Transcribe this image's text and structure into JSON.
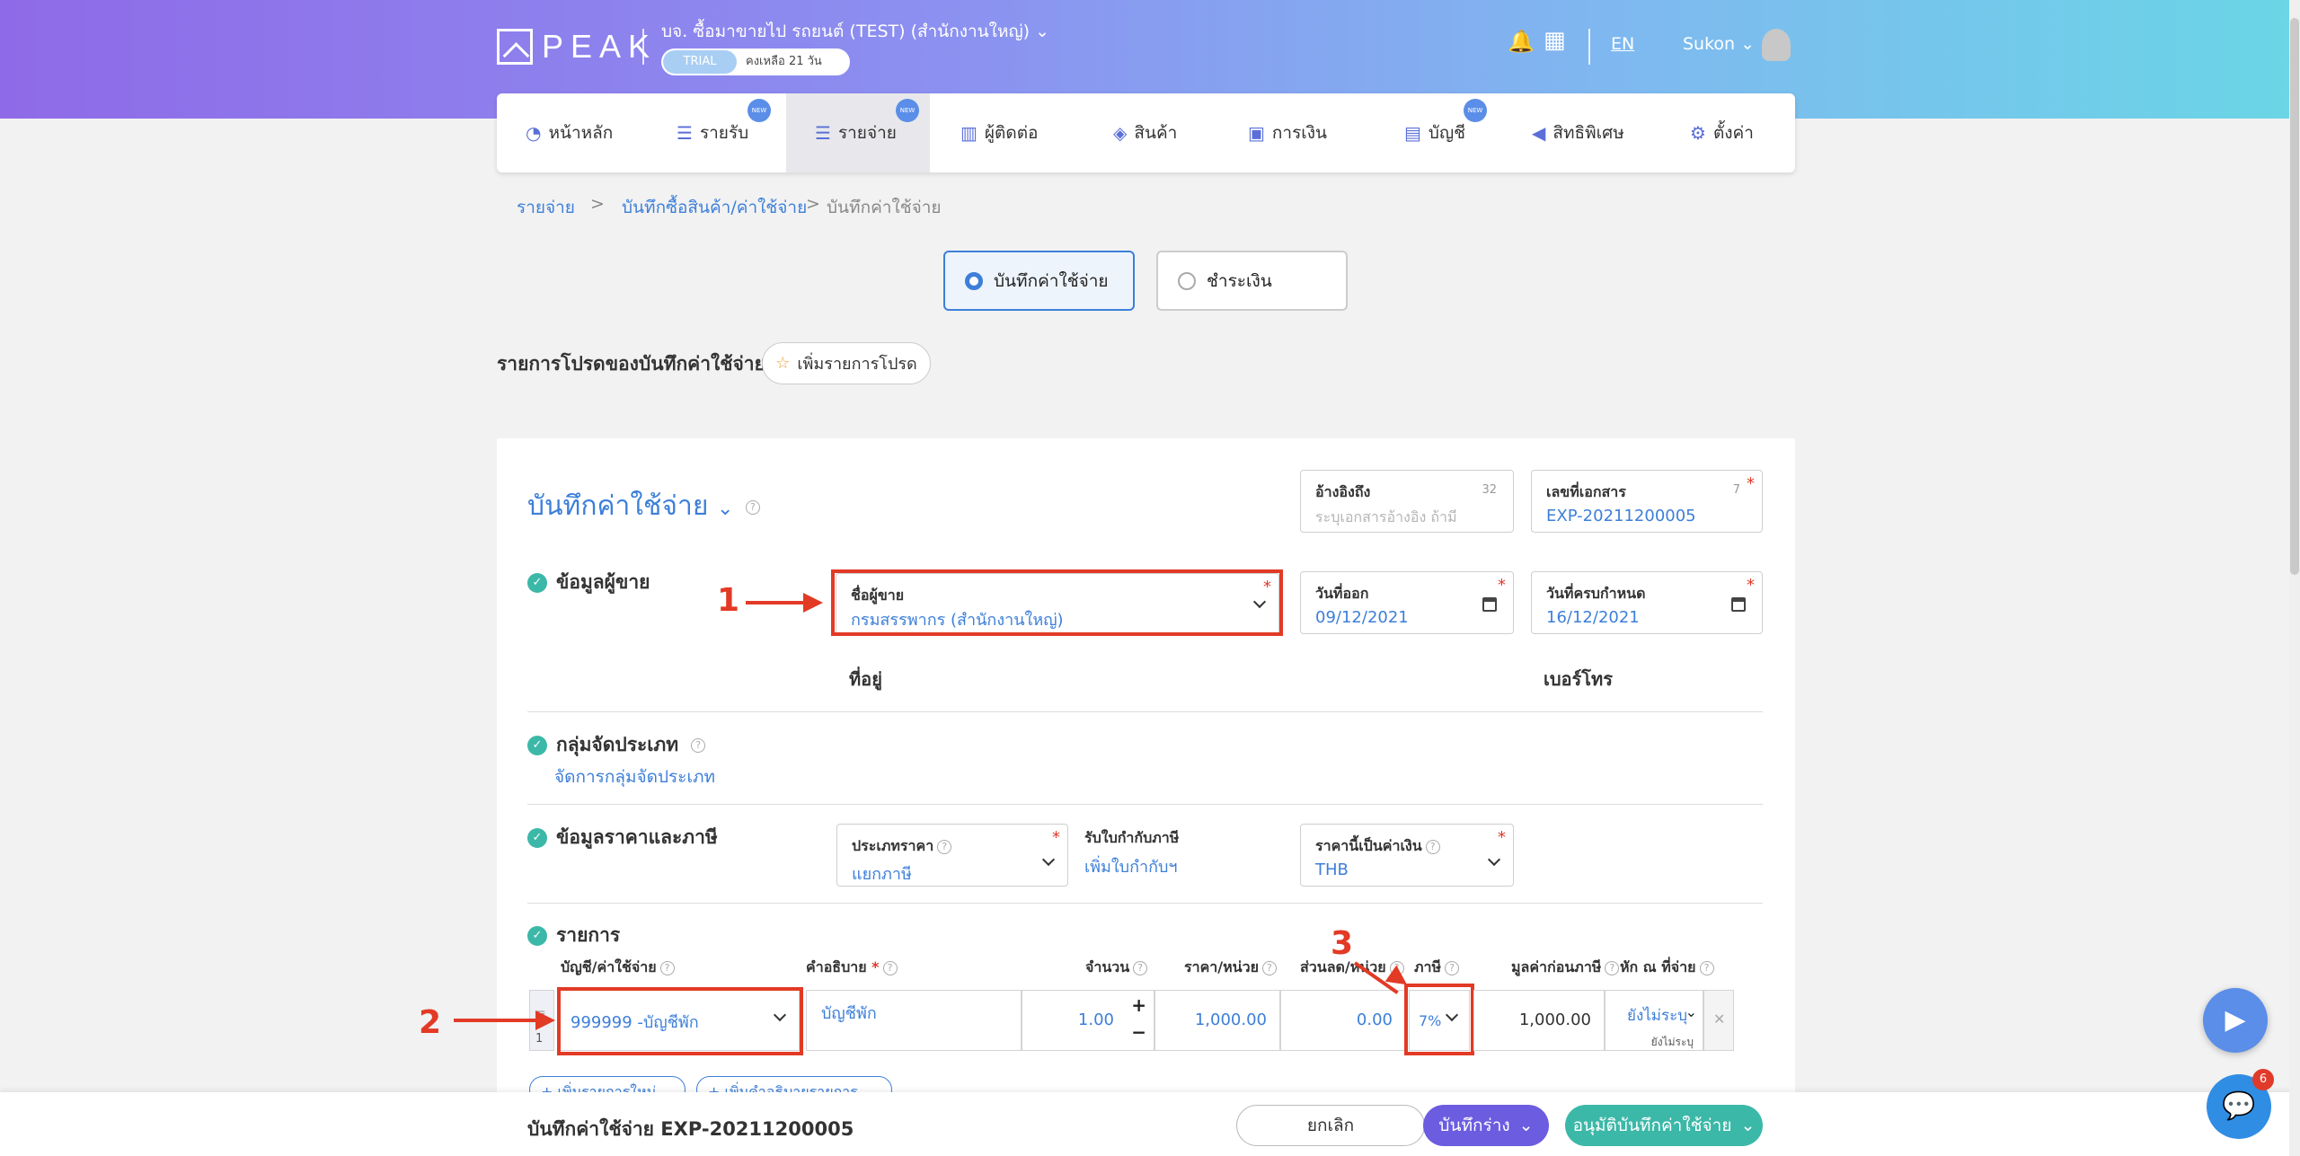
{
  "header": {
    "logo_text": "PEAK",
    "company": "บจ. ซื้อมาขายไป รถยนต์ (TEST) (สำนักงานใหญ่)",
    "trial_label": "TRIAL",
    "trial_days": "คงเหลือ 21 วัน",
    "lang": "EN",
    "user": "Sukon"
  },
  "nav": {
    "items": [
      {
        "label": "หน้าหลัก",
        "icon": "dashboard-icon"
      },
      {
        "label": "รายรับ",
        "icon": "income-icon",
        "badge": "NEW"
      },
      {
        "label": "รายจ่าย",
        "icon": "expense-icon",
        "badge": "NEW"
      },
      {
        "label": "ผู้ติดต่อ",
        "icon": "contacts-icon"
      },
      {
        "label": "สินค้า",
        "icon": "box-icon"
      },
      {
        "label": "การเงิน",
        "icon": "money-icon"
      },
      {
        "label": "บัญชี",
        "icon": "book-icon",
        "badge": "NEW"
      },
      {
        "label": "สิทธิพิเศษ",
        "icon": "megaphone-icon"
      },
      {
        "label": "ตั้งค่า",
        "icon": "gear-icon"
      }
    ]
  },
  "breadcrumb": {
    "b1": "รายจ่าย",
    "sep": ">",
    "b2": "บันทึกซื้อสินค้า/ค่าใช้จ่าย",
    "b3": "บันทึกค่าใช้จ่าย"
  },
  "mode": {
    "opt1": "บันทึกค่าใช้จ่าย",
    "opt2": "ชำระเงิน"
  },
  "favorites": {
    "title": "รายการโปรดของบันทึกค่าใช้จ่าย",
    "add_button": "เพิ่มรายการโปรด"
  },
  "form": {
    "title": "บันทึกค่าใช้จ่าย",
    "reference": {
      "label": "อ้างอิงถึง",
      "placeholder": "ระบุเอกสารอ้างอิง ถ้ามี",
      "count": "32"
    },
    "doc_number": {
      "label": "เลขที่เอกสาร",
      "value": "EXP-20211200005",
      "count": "7"
    },
    "vendor_section": "ข้อมูลผู้ขาย",
    "vendor": {
      "label": "ชื่อผู้ขาย",
      "value": "กรมสรรพากร (สำนักงานใหญ่)"
    },
    "issue_date": {
      "label": "วันที่ออก",
      "value": "09/12/2021"
    },
    "due_date": {
      "label": "วันที่ครบกำหนด",
      "value": "16/12/2021"
    },
    "address_label": "ที่อยู่",
    "phone_label": "เบอร์โทร",
    "group_section": "กลุ่มจัดประเภท",
    "group_link": "จัดการกลุ่มจัดประเภท",
    "price_section": "ข้อมูลราคาและภาษี",
    "price_type": {
      "label": "ประเภทราคา",
      "value": "แยกภาษี"
    },
    "tax_invoice": {
      "label": "รับใบกำกับภาษี",
      "link": "เพิ่มใบกำกับฯ"
    },
    "currency": {
      "label": "ราคานี้เป็นค่าเงิน",
      "value": "THB"
    },
    "items_section": "รายการ"
  },
  "table": {
    "headers": {
      "account": "บัญชี/ค่าใช้จ่าย",
      "desc": "คำอธิบาย",
      "qty": "จำนวน",
      "price": "ราคา/หน่วย",
      "discount": "ส่วนลด/หน่วย",
      "tax": "ภาษี",
      "pretax": "มูลค่าก่อนภาษี",
      "wht": "หัก ณ ที่จ่าย"
    },
    "row": {
      "num": "1",
      "account": "999999 -บัญชีพัก",
      "desc": "บัญชีพัก",
      "qty": "1.00",
      "price": "1,000.00",
      "discount": "0.00",
      "tax": "7%",
      "pretax": "1,000.00",
      "wht": "ยังไม่ระบุ",
      "wht_sub": "ยังไม่ระบุ"
    },
    "add_row": "เพิ่มรายการใหม่",
    "add_desc": "เพิ่มคำอธิบายรายการ"
  },
  "annotations": {
    "a1": "1",
    "a2": "2",
    "a3": "3"
  },
  "footer": {
    "doc_title": "บันทึกค่าใช้จ่าย EXP-20211200005",
    "cancel": "ยกเลิก",
    "draft": "บันทึกร่าง",
    "approve": "อนุมัติบันทึกค่าใช้จ่าย"
  },
  "chat_badge": "6",
  "colors": {
    "accent": "#3d7fd9",
    "annotation": "#e23a25",
    "approve": "#3cb8a8",
    "draft": "#6c5ce0"
  }
}
